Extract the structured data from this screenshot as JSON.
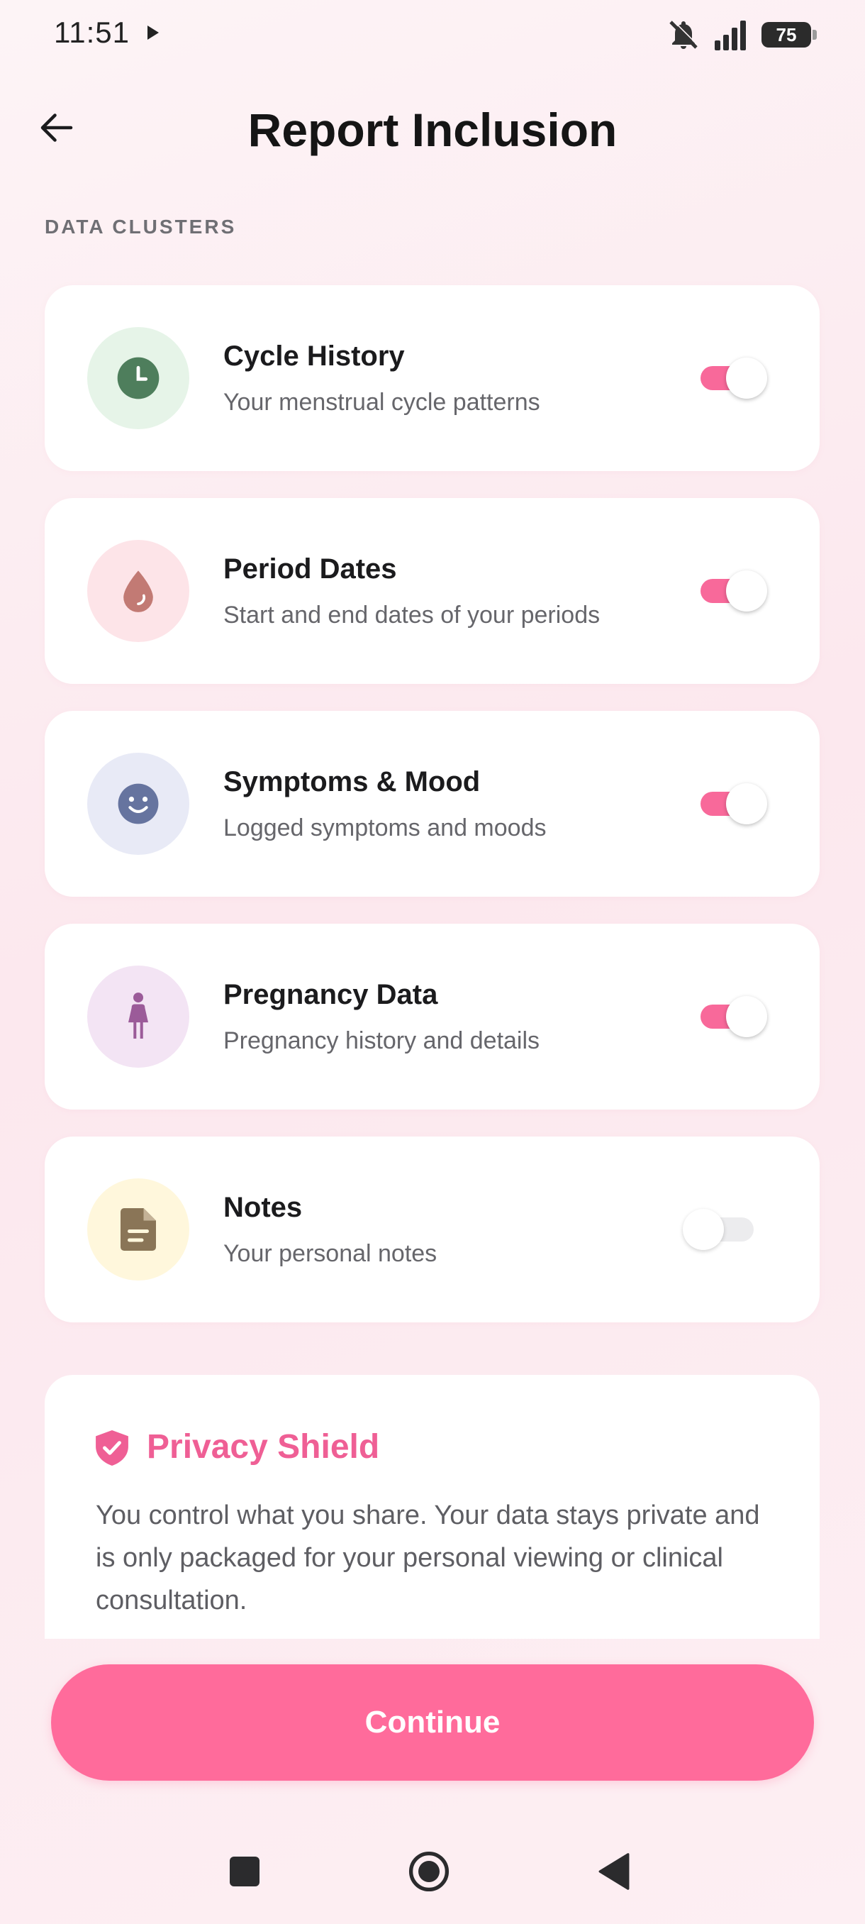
{
  "status_bar": {
    "time": "11:51",
    "battery": "75"
  },
  "header": {
    "title": "Report Inclusion"
  },
  "section_label": "DATA CLUSTERS",
  "clusters": [
    {
      "title": "Cycle History",
      "subtitle": "Your menstrual cycle patterns",
      "icon": "clock-icon",
      "icon_bg": "#e6f4e8",
      "icon_color": "#4e7e5c",
      "enabled": true
    },
    {
      "title": "Period Dates",
      "subtitle": "Start and end dates of your periods",
      "icon": "drop-icon",
      "icon_bg": "#fde4e8",
      "icon_color": "#c27a74",
      "enabled": true
    },
    {
      "title": "Symptoms & Mood",
      "subtitle": "Logged symptoms and moods",
      "icon": "smiley-icon",
      "icon_bg": "#e8eaf6",
      "icon_color": "#66749f",
      "enabled": true
    },
    {
      "title": "Pregnancy Data",
      "subtitle": "Pregnancy history and details",
      "icon": "pregnant-woman-icon",
      "icon_bg": "#f3e4f4",
      "icon_color": "#9b5b99",
      "enabled": true
    },
    {
      "title": "Notes",
      "subtitle": "Your personal notes",
      "icon": "document-icon",
      "icon_bg": "#fff7dc",
      "icon_color": "#8a7557",
      "enabled": false
    }
  ],
  "privacy": {
    "title": "Privacy Shield",
    "body": "You control what you share. Your data stays private and is only packaged for your personal viewing or clinical consultation."
  },
  "continue_label": "Continue",
  "colors": {
    "accent": "#ff6b9b",
    "toggle_on": "#f8699a",
    "toggle_off": "#ececee",
    "privacy_title": "#ef5f95"
  }
}
